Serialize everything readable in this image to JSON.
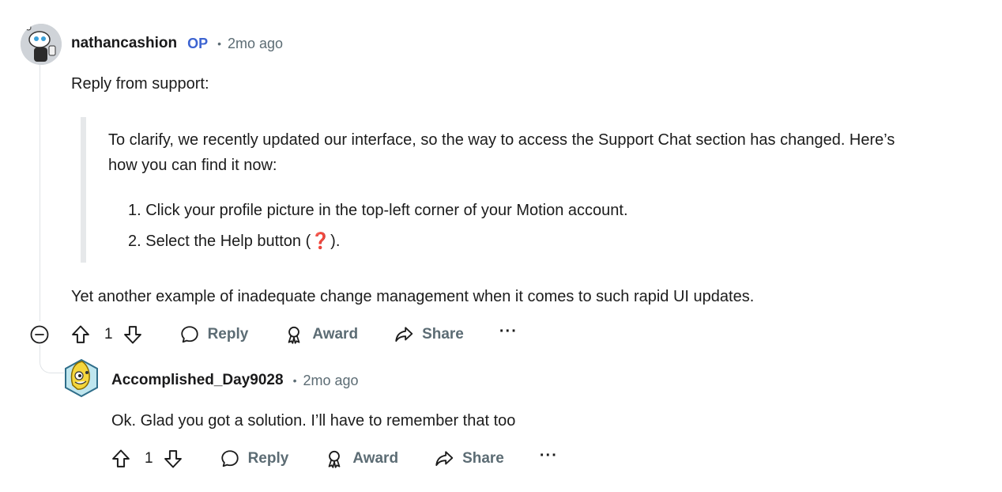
{
  "comments": [
    {
      "author": "nathancashion",
      "op_badge": "OP",
      "separator": "•",
      "time": "2mo ago",
      "avatar_icon": "snoo-avatar-icon",
      "intro": "Reply from support:",
      "quote": "To clarify, we recently updated our interface, so the way to access the Support Chat section has changed. Here’s how you can find it now:",
      "list": [
        "1. Click your profile picture in the top-left corner of your Motion account.",
        "2. Select the Help button ("
      ],
      "list_tail": ").",
      "help_icon": "❓",
      "outro": "Yet another example of inadequate change management when it comes to such rapid UI updates.",
      "votes": "1",
      "actions": {
        "reply": "Reply",
        "award": "Award",
        "share": "Share",
        "more": "···"
      }
    },
    {
      "author": "Accomplished_Day9028",
      "separator": "•",
      "time": "2mo ago",
      "avatar_icon": "snoo-avatar-icon",
      "body": "Ok. Glad you got a solution. I’ll have to remember that too",
      "votes": "1",
      "actions": {
        "reply": "Reply",
        "award": "Award",
        "share": "Share",
        "more": "···"
      }
    }
  ],
  "colors": {
    "op_badge": "#3d64d1",
    "meta": "#5c6c74",
    "thread_line": "#dfe3e6",
    "quote_bar": "#e6e8ea",
    "help_icon": "#d62b2b"
  }
}
